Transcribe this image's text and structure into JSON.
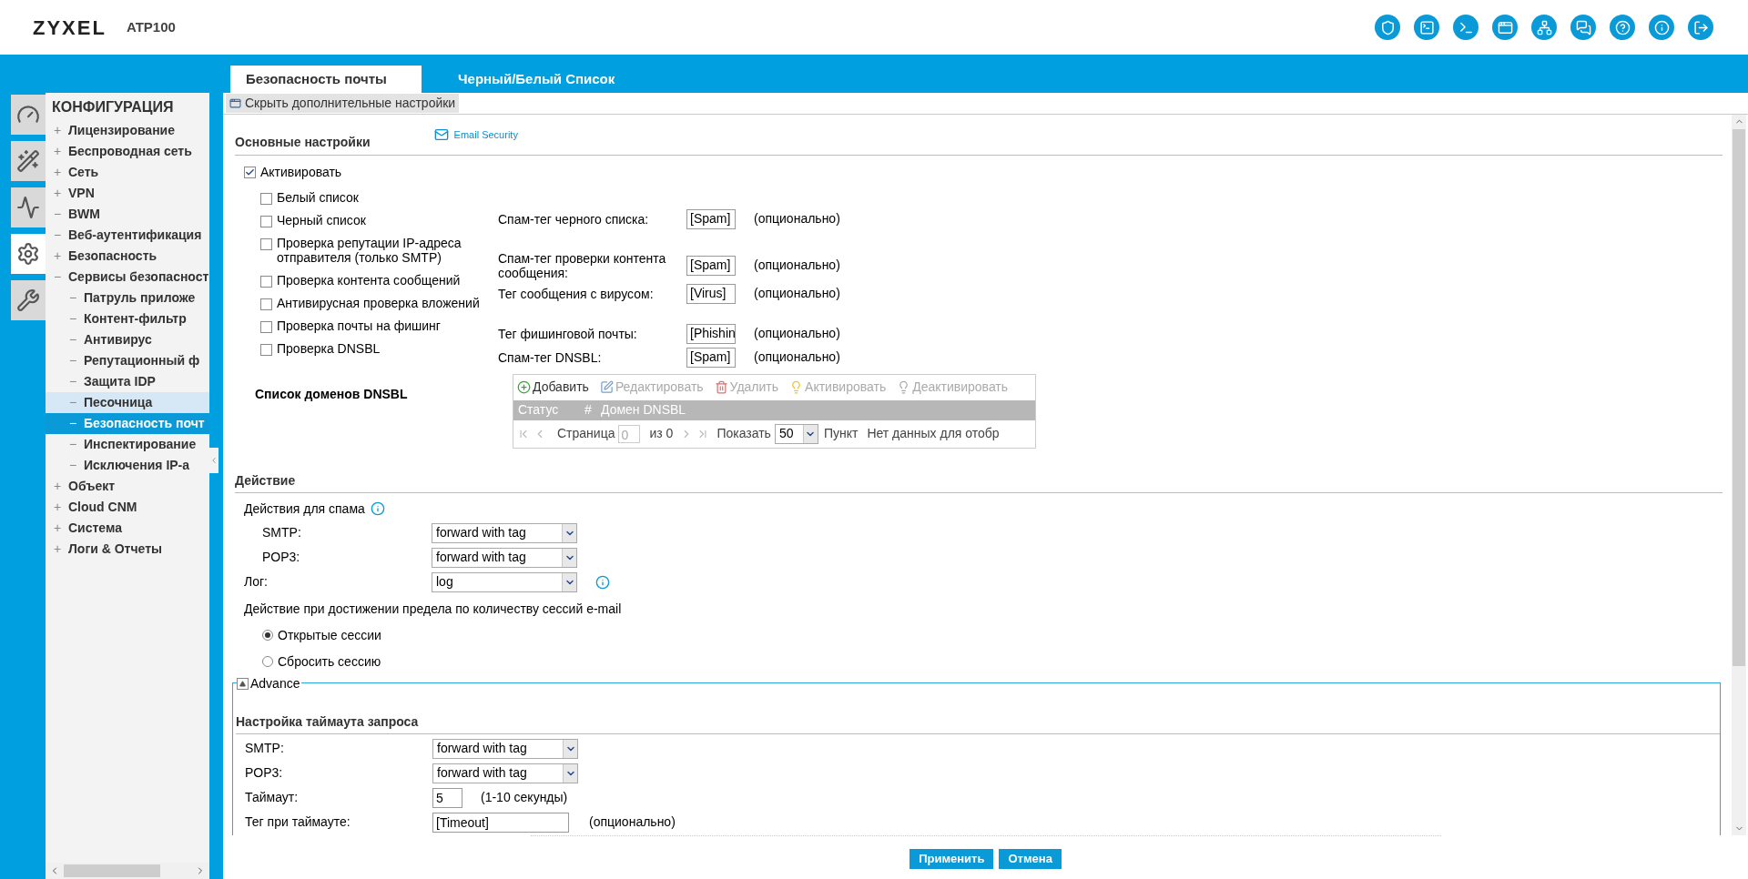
{
  "header": {
    "brand": "ZYXEL",
    "model": "ATP100",
    "icons": [
      {
        "kind": "shield"
      },
      {
        "kind": "console"
      },
      {
        "kind": "cli"
      },
      {
        "kind": "window"
      },
      {
        "kind": "network"
      },
      {
        "kind": "chat"
      },
      {
        "kind": "help"
      },
      {
        "kind": "info"
      },
      {
        "kind": "logout"
      }
    ]
  },
  "rail": [
    {
      "kind": "gauge",
      "selected": false
    },
    {
      "kind": "wand",
      "selected": false
    },
    {
      "kind": "monitor",
      "selected": false
    },
    {
      "kind": "settings",
      "selected": true
    },
    {
      "kind": "tools",
      "selected": false
    }
  ],
  "sidebar": {
    "title": "КОНФИГУРАЦИЯ",
    "items": [
      {
        "sign": "+",
        "label": "Лицензирование",
        "selected": false,
        "hovered": false
      },
      {
        "sign": "+",
        "label": "Беспроводная сеть",
        "selected": false,
        "hovered": false
      },
      {
        "sign": "+",
        "label": "Сеть",
        "selected": false,
        "hovered": false
      },
      {
        "sign": "+",
        "label": "VPN",
        "selected": false,
        "hovered": false
      },
      {
        "sign": "−",
        "label": "BWM",
        "selected": false,
        "hovered": false
      },
      {
        "sign": "−",
        "label": "Веб-аутентификация",
        "selected": false,
        "hovered": false
      },
      {
        "sign": "+",
        "label": "Безопасность",
        "selected": false,
        "hovered": false
      },
      {
        "sign": "−",
        "label": "Сервисы безопасност",
        "selected": false,
        "hovered": false,
        "children": [
          {
            "sign": "−",
            "label": "Патруль приложе",
            "selected": false,
            "hovered": false
          },
          {
            "sign": "−",
            "label": "Контент-фильтр",
            "selected": false,
            "hovered": false
          },
          {
            "sign": "−",
            "label": "Антивирус",
            "selected": false,
            "hovered": false
          },
          {
            "sign": "−",
            "label": "Репутационный ф",
            "selected": false,
            "hovered": false
          },
          {
            "sign": "−",
            "label": "Защита IDP",
            "selected": false,
            "hovered": false
          },
          {
            "sign": "−",
            "label": "Песочница",
            "selected": false,
            "hovered": true
          },
          {
            "sign": "−",
            "label": "Безопасность почт",
            "selected": true,
            "hovered": false
          },
          {
            "sign": "−",
            "label": "Инспектирование",
            "selected": false,
            "hovered": false
          },
          {
            "sign": "−",
            "label": "Исключения IP-а",
            "selected": false,
            "hovered": false
          }
        ]
      },
      {
        "sign": "+",
        "label": "Объект",
        "selected": false,
        "hovered": false
      },
      {
        "sign": "+",
        "label": "Cloud CNM",
        "selected": false,
        "hovered": false
      },
      {
        "sign": "+",
        "label": "Система",
        "selected": false,
        "hovered": false
      },
      {
        "sign": "+",
        "label": "Логи & Отчеты",
        "selected": false,
        "hovered": false
      }
    ]
  },
  "tabs": [
    {
      "label": "Безопасность почты",
      "selected": true
    },
    {
      "label": "Черный/Белый Список",
      "selected": false
    }
  ],
  "toolbar_link": "Скрыть дополнительные настройки",
  "basic": {
    "title": "Основные настройки",
    "badge": "Email Security",
    "activate": {
      "label": "Активировать",
      "checked": true
    },
    "options": [
      {
        "label": "Белый список",
        "checked": false
      },
      {
        "label": "Черный список",
        "checked": false
      },
      {
        "label": "Проверка репутации IP-адреса отправителя (только SMTP)",
        "checked": false
      },
      {
        "label": "Проверка контента сообщений",
        "checked": false
      },
      {
        "label": "Антивирусная проверка вложений",
        "checked": false
      },
      {
        "label": "Проверка почты на фишинг",
        "checked": false
      },
      {
        "label": "Проверка DNSBL",
        "checked": false
      }
    ],
    "tags": [
      {
        "label": "Спам-тег черного списка:",
        "value": "[Spam]",
        "note": "(опционально)"
      },
      {
        "label": "Спам-тег проверки контента сообщения:",
        "value": "[Spam]",
        "note": "(опционально)"
      },
      {
        "label": "Тег сообщения с вирусом:",
        "value": "[Virus]",
        "note": "(опционально)"
      },
      {
        "label": "Тег фишинговой почты:",
        "value": "[Phishin",
        "note": "(опционально)"
      },
      {
        "label": "Спам-тег DNSBL:",
        "value": "[Spam]",
        "note": "(опционально)"
      }
    ]
  },
  "dnsbl": {
    "title": "Список доменов DNSBL",
    "actions": [
      {
        "kind": "add",
        "label": "Добавить",
        "disabled": false
      },
      {
        "kind": "edit",
        "label": "Редактировать",
        "disabled": true
      },
      {
        "kind": "delete",
        "label": "Удалить",
        "disabled": true
      },
      {
        "kind": "activate",
        "label": "Активировать",
        "disabled": true
      },
      {
        "kind": "deactivate",
        "label": "Деактивировать",
        "disabled": true
      }
    ],
    "columns": [
      "Статус",
      "#",
      "Домен DNSBL"
    ],
    "pager": {
      "page_label": "Страница",
      "page": "0",
      "of": "из 0",
      "show_label": "Показать",
      "per_page": "50",
      "unit": "Пункт",
      "empty": "Нет данных для отобр"
    }
  },
  "action": {
    "title": "Действие",
    "spam_label": "Действия для спама",
    "spam_rows": [
      {
        "label": "SMTP:",
        "value": "forward with tag"
      },
      {
        "label": "POP3:",
        "value": "forward with tag"
      }
    ],
    "log": {
      "label": "Лог:",
      "value": "log"
    },
    "limit_label": "Действие при достижении предела по количеству сессий e-mail",
    "radios": [
      {
        "label": "Открытые сессии",
        "selected": true
      },
      {
        "label": "Сбросить сессию",
        "selected": false
      }
    ]
  },
  "advance": {
    "legend": "Advance",
    "expanded": true,
    "title": "Настройка таймаута запроса",
    "rows": [
      {
        "label": "SMTP:",
        "value": "forward with tag"
      },
      {
        "label": "POP3:",
        "value": "forward with tag"
      }
    ],
    "timeout": {
      "label": "Таймаут:",
      "value": "5",
      "note": "(1-10 секунды)"
    },
    "tag": {
      "label": "Тег при таймауте:",
      "value": "[Timeout]",
      "note": "(опционально)"
    }
  },
  "buttons": [
    {
      "label": "Применить"
    },
    {
      "label": "Отмена"
    }
  ]
}
